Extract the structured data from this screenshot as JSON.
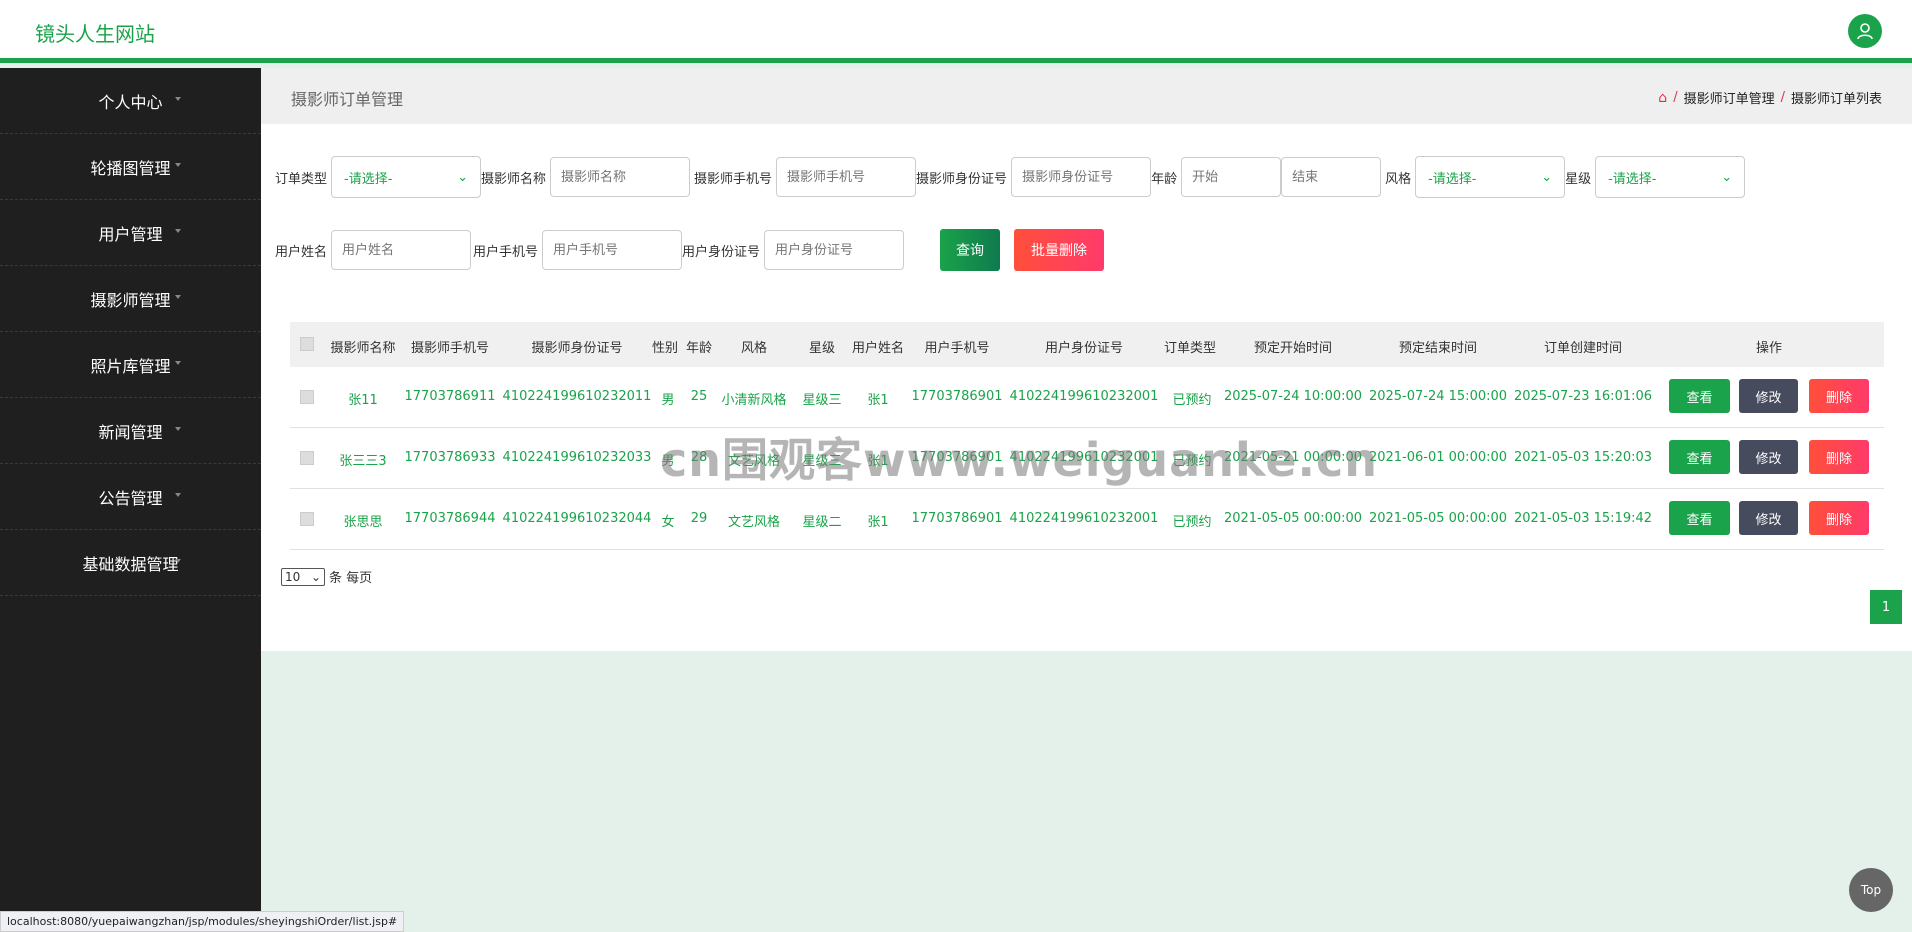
{
  "header": {
    "brand": "镜头人生网站"
  },
  "sidebar": {
    "items": [
      {
        "label": "个人中心"
      },
      {
        "label": "轮播图管理"
      },
      {
        "label": "用户管理"
      },
      {
        "label": "摄影师管理"
      },
      {
        "label": "照片库管理"
      },
      {
        "label": "新闻管理"
      },
      {
        "label": "公告管理"
      },
      {
        "label": "基础数据管理"
      }
    ]
  },
  "page": {
    "title": "摄影师订单管理",
    "breadcrumb": [
      "摄影师订单管理",
      "摄影师订单列表"
    ]
  },
  "search": {
    "order_type_label": "订单类型",
    "order_type_value": "-请选择-",
    "photographer_name_label": "摄影师名称",
    "photographer_name_placeholder": "摄影师名称",
    "photographer_phone_label": "摄影师手机号",
    "photographer_phone_placeholder": "摄影师手机号",
    "photographer_id_label": "摄影师身份证号",
    "photographer_id_placeholder": "摄影师身份证号",
    "age_label": "年龄",
    "age_start_placeholder": "开始",
    "age_end_placeholder": "结束",
    "style_label": "风格",
    "style_value": "-请选择-",
    "star_label": "星级",
    "star_value": "-请选择-",
    "user_name_label": "用户姓名",
    "user_name_placeholder": "用户姓名",
    "user_phone_label": "用户手机号",
    "user_phone_placeholder": "用户手机号",
    "user_id_label": "用户身份证号",
    "user_id_placeholder": "用户身份证号",
    "query_button": "查询",
    "batch_delete_button": "批量删除"
  },
  "table": {
    "headers": [
      "摄影师名称",
      "摄影师手机号",
      "摄影师身份证号",
      "性别",
      "年龄",
      "风格",
      "星级",
      "用户姓名",
      "用户手机号",
      "用户身份证号",
      "订单类型",
      "预定开始时间",
      "预定结束时间",
      "订单创建时间",
      "操作"
    ],
    "rows": [
      [
        "张11",
        "17703786911",
        "410224199610232011",
        "男",
        "25",
        "小清新风格",
        "星级三",
        "张1",
        "17703786901",
        "410224199610232001",
        "已预约",
        "2025-07-24 10:00:00",
        "2025-07-24 15:00:00",
        "2025-07-23 16:01:06"
      ],
      [
        "张三三3",
        "17703786933",
        "410224199610232033",
        "男",
        "28",
        "文艺风格",
        "星级三",
        "张1",
        "17703786901",
        "410224199610232001",
        "已预约",
        "2021-05-21 00:00:00",
        "2021-06-01 00:00:00",
        "2021-05-03 15:20:03"
      ],
      [
        "张思思",
        "17703786944",
        "410224199610232044",
        "女",
        "29",
        "文艺风格",
        "星级二",
        "张1",
        "17703786901",
        "410224199610232001",
        "已预约",
        "2021-05-05 00:00:00",
        "2021-05-05 00:00:00",
        "2021-05-03 15:19:42"
      ]
    ],
    "actions": {
      "view": "查看",
      "edit": "修改",
      "delete": "删除"
    }
  },
  "pagination": {
    "page_size": "10",
    "page_size_suffix": "条 每页",
    "current_page": "1"
  },
  "back_to_top": "Top",
  "status_url": "localhost:8080/yuepaiwangzhan/jsp/modules/sheyingshiOrder/list.jsp#",
  "watermark": "cn围观客www.weiguanke.cn",
  "colors": {
    "accent": "#1aa34a",
    "sidebar": "#1f1f1f",
    "danger": "#ff4059",
    "edit": "#474b5e"
  }
}
